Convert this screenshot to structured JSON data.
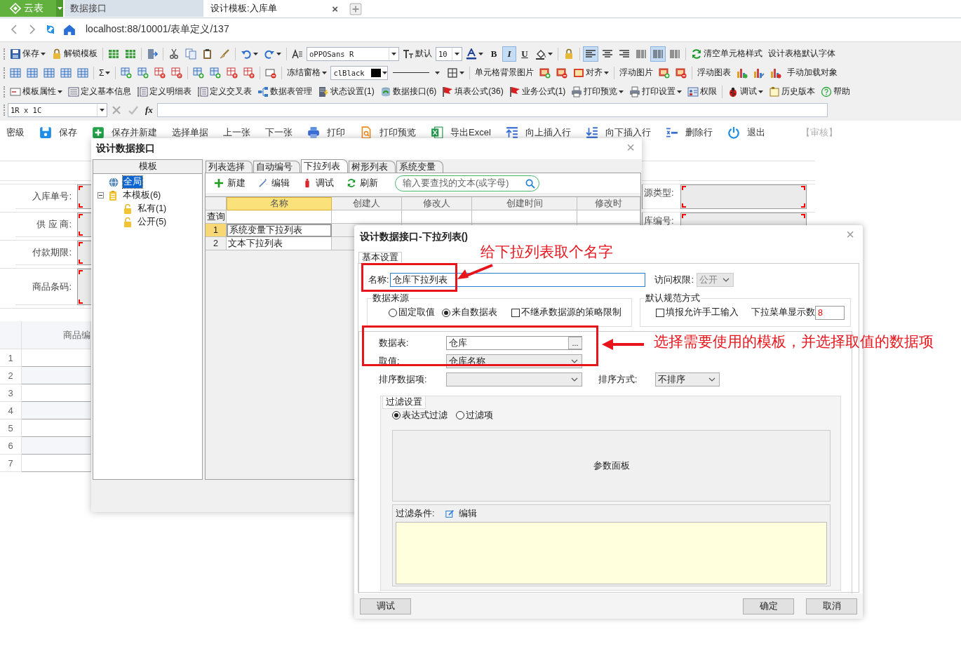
{
  "app_tabs": [
    {
      "kind": "logo",
      "label": "云表"
    },
    {
      "kind": "tab",
      "label": "数据接口",
      "selected": false
    },
    {
      "kind": "tab",
      "label": "设计模板:入库单",
      "selected": true,
      "close": "×"
    }
  ],
  "address": {
    "url": "localhost:88/10001/表单定义/137"
  },
  "toolbar": {
    "rows": [
      {
        "items": [
          {
            "kind": "button",
            "label": "保存",
            "menu": true
          },
          {
            "kind": "button",
            "label": "解锁模板",
            "menu": false
          },
          {
            "kind": "sep"
          },
          {
            "kind": "button",
            "menu": false
          },
          {
            "kind": "button",
            "menu": false
          },
          {
            "kind": "sep"
          },
          {
            "kind": "button",
            "menu": false
          },
          {
            "kind": "sep"
          },
          {
            "kind": "button",
            "menu": false
          },
          {
            "kind": "button",
            "menu": false
          },
          {
            "kind": "button",
            "menu": false
          },
          {
            "kind": "button",
            "menu": false
          },
          {
            "kind": "sep"
          },
          {
            "kind": "button",
            "menu": true
          },
          {
            "kind": "button",
            "menu": true
          },
          {
            "kind": "sep"
          },
          {
            "kind": "button",
            "menu": false
          },
          {
            "kind": "combo",
            "value": "oPPOSans R"
          },
          {
            "kind": "button",
            "label": "默认",
            "menu": false
          },
          {
            "kind": "combo",
            "value": "10"
          },
          {
            "kind": "button",
            "menu": true
          },
          {
            "kind": "toggle",
            "label": "B",
            "selected": false
          },
          {
            "kind": "toggle",
            "label": "I",
            "selected": true
          },
          {
            "kind": "toggle",
            "label": "U",
            "selected": false
          },
          {
            "kind": "button",
            "menu": true
          },
          {
            "kind": "sep"
          },
          {
            "kind": "button",
            "menu": false
          },
          {
            "kind": "sep"
          },
          {
            "kind": "toggle",
            "selected": true
          },
          {
            "kind": "toggle",
            "selected": false
          },
          {
            "kind": "toggle",
            "selected": false
          },
          {
            "kind": "toggle",
            "selected": false
          },
          {
            "kind": "toggle",
            "selected": true
          },
          {
            "kind": "toggle",
            "selected": false
          },
          {
            "kind": "sep"
          },
          {
            "kind": "button",
            "label": "清空单元格样式",
            "menu": false
          },
          {
            "kind": "text",
            "label": "设计表格默认字体",
            "menu": false
          }
        ]
      },
      {
        "items": [
          {
            "kind": "button",
            "menu": false
          },
          {
            "kind": "button",
            "menu": false
          },
          {
            "kind": "button",
            "menu": false
          },
          {
            "kind": "button",
            "menu": false
          },
          {
            "kind": "button",
            "menu": false
          },
          {
            "kind": "sep"
          },
          {
            "kind": "text",
            "label": "Σ",
            "menu": true
          },
          {
            "kind": "sep"
          },
          {
            "kind": "button",
            "menu": false
          },
          {
            "kind": "button",
            "menu": false
          },
          {
            "kind": "button",
            "menu": false
          },
          {
            "kind": "button",
            "menu": false
          },
          {
            "kind": "sep"
          },
          {
            "kind": "button",
            "menu": false
          },
          {
            "kind": "button",
            "menu": false
          },
          {
            "kind": "button",
            "menu": false
          },
          {
            "kind": "button",
            "menu": false
          },
          {
            "kind": "sep"
          },
          {
            "kind": "button",
            "menu": false
          },
          {
            "kind": "sep"
          },
          {
            "kind": "text",
            "label": "冻结窗格",
            "menu": true
          },
          {
            "kind": "color-combo",
            "value": "clBlack",
            "color": "#000000"
          },
          {
            "kind": "line-combo"
          },
          {
            "kind": "button",
            "menu": true
          },
          {
            "kind": "sep"
          },
          {
            "kind": "text",
            "label": "单元格背景图片",
            "menu": false
          },
          {
            "kind": "button",
            "menu": false
          },
          {
            "kind": "button",
            "menu": false
          },
          {
            "kind": "button",
            "label": "对齐",
            "menu": true
          },
          {
            "kind": "sep"
          },
          {
            "kind": "text",
            "label": "浮动图片",
            "menu": false
          },
          {
            "kind": "button",
            "menu": false
          },
          {
            "kind": "button",
            "menu": false
          },
          {
            "kind": "sep"
          },
          {
            "kind": "text",
            "label": "浮动图表",
            "menu": false
          },
          {
            "kind": "button",
            "menu": false
          },
          {
            "kind": "button",
            "menu": false
          },
          {
            "kind": "button",
            "menu": false
          },
          {
            "kind": "text",
            "label": "手动加载对象",
            "menu": false
          }
        ]
      },
      {
        "items": [
          {
            "kind": "button",
            "label": "模板属性",
            "menu": true
          },
          {
            "kind": "button",
            "label": "定义基本信息",
            "menu": false
          },
          {
            "kind": "button",
            "label": "定义明细表",
            "menu": false
          },
          {
            "kind": "button",
            "label": "定义交叉表",
            "menu": false
          },
          {
            "kind": "button",
            "label": "数据表管理",
            "menu": false
          },
          {
            "kind": "button",
            "label": "状态设置(1)",
            "menu": false
          },
          {
            "kind": "button",
            "label": "数据接口(6)",
            "menu": false
          },
          {
            "kind": "button",
            "label": "填表公式(36)",
            "menu": false
          },
          {
            "kind": "button",
            "label": "业务公式(1)",
            "menu": false
          },
          {
            "kind": "button",
            "label": "打印预览",
            "menu": true
          },
          {
            "kind": "button",
            "label": "打印设置",
            "menu": true
          },
          {
            "kind": "button",
            "label": "权限",
            "menu": false
          },
          {
            "kind": "sep"
          },
          {
            "kind": "button",
            "label": "调试",
            "menu": true
          },
          {
            "kind": "button",
            "label": "历史版本",
            "menu": false
          },
          {
            "kind": "button",
            "label": "帮助",
            "menu": false
          }
        ]
      }
    ],
    "formula": {
      "cell": "1R x 1C",
      "fx": "fx"
    }
  },
  "actions": [
    {
      "kind": "text",
      "label": "密級",
      "disabled": false
    },
    {
      "kind": "button",
      "label": "保存",
      "disabled": false
    },
    {
      "kind": "button",
      "label": "保存并新建",
      "disabled": false
    },
    {
      "kind": "text",
      "label": "选择单据",
      "disabled": false
    },
    {
      "kind": "text",
      "label": "上一张",
      "disabled": false
    },
    {
      "kind": "text",
      "label": "下一张",
      "disabled": false
    },
    {
      "kind": "button",
      "label": "打印",
      "disabled": false
    },
    {
      "kind": "button",
      "label": "打印预览",
      "disabled": false
    },
    {
      "kind": "button",
      "label": "导出Excel",
      "disabled": false
    },
    {
      "kind": "button",
      "label": "向上插入行",
      "disabled": false
    },
    {
      "kind": "button",
      "label": "向下插入行",
      "disabled": false
    },
    {
      "kind": "button",
      "label": "删除行",
      "disabled": false
    },
    {
      "kind": "button",
      "label": "退出",
      "disabled": false
    },
    {
      "kind": "text",
      "label": "【审核】",
      "disabled": true
    }
  ],
  "form": {
    "fields_left": [
      {
        "label": "入库单号:"
      },
      {
        "label": "供 应 商:"
      },
      {
        "label": "付款期限:"
      },
      {
        "label": "商品条码:"
      }
    ],
    "fields_right": [
      {
        "label": "源类型:"
      },
      {
        "label": "库编号:"
      }
    ],
    "detail": {
      "header": "商品编",
      "rows": [
        "1",
        "2",
        "3",
        "4",
        "5",
        "6",
        "7"
      ]
    }
  },
  "dialog_main": {
    "title": "设计数据接口",
    "close": "×",
    "tree": {
      "header": "模板",
      "items": [
        {
          "label": "全局",
          "selected": true
        },
        {
          "label": "本模板(6)",
          "selected": false,
          "expanded": true,
          "children": [
            {
              "label": "私有(1)",
              "selected": false
            },
            {
              "label": "公开(5)",
              "selected": false
            }
          ]
        }
      ]
    },
    "tabs": [
      {
        "label": "列表选择",
        "selected": false
      },
      {
        "label": "自动编号",
        "selected": false
      },
      {
        "label": "下拉列表",
        "selected": true
      },
      {
        "label": "树形列表",
        "selected": false
      },
      {
        "label": "系统变量",
        "selected": false
      }
    ],
    "tools": [
      {
        "label": "新建"
      },
      {
        "label": "编辑"
      },
      {
        "label": "调试"
      },
      {
        "label": "刷新"
      }
    ],
    "search": {
      "placeholder": "输入要查找的文本(或字母)"
    },
    "grid": {
      "columns": [
        {
          "label": "名称",
          "selected": true
        },
        {
          "label": "创建人",
          "selected": false
        },
        {
          "label": "修改人",
          "selected": false
        },
        {
          "label": "创建时间",
          "selected": false
        },
        {
          "label": "修改时",
          "selected": false
        }
      ],
      "filter_label": "查询",
      "rows": [
        {
          "index": "1",
          "name": "系统变量下拉列表",
          "selected": true
        },
        {
          "index": "2",
          "name": "文本下拉列表",
          "selected": false
        }
      ]
    }
  },
  "dialog_list": {
    "title": "设计数据接口-下拉列表()",
    "close": "×",
    "tab": "基本设置",
    "name": {
      "label": "名称:",
      "value": "仓库下拉列表"
    },
    "access": {
      "label": "访问权限:",
      "value": "公开",
      "disabled": true
    },
    "source": {
      "legend": "数据来源",
      "options": [
        {
          "label": "固定取值",
          "selected": false
        },
        {
          "label": "来自数据表",
          "selected": true
        }
      ],
      "no_inherit": {
        "label": "不继承数据源的策略限制",
        "checked": false
      }
    },
    "defaults": {
      "legend": "默认规范方式",
      "manual": {
        "label": "填报允许手工输入",
        "checked": false
      },
      "count": {
        "label": "下拉菜单显示数",
        "value": "8"
      }
    },
    "table": {
      "label": "数据表:",
      "value": "仓库",
      "browse": "..."
    },
    "value_field": {
      "label": "取值:",
      "value": "仓库名称"
    },
    "sort_field": {
      "label": "排序数据项:"
    },
    "sort_order": {
      "label": "排序方式:",
      "value": "不排序"
    },
    "filter": {
      "tab": "过滤设置",
      "modes": [
        {
          "label": "表达式过滤",
          "selected": true
        },
        {
          "label": "过滤项",
          "selected": false
        }
      ],
      "panel": "参数面板",
      "condition": {
        "label": "过滤条件:",
        "edit": "编辑"
      }
    },
    "buttons": [
      {
        "label": "调试"
      },
      {
        "label": "确定"
      },
      {
        "label": "取消"
      }
    ]
  },
  "annotations": [
    {
      "kind": "callout",
      "text": "给下拉列表取个名字"
    },
    {
      "kind": "callout",
      "text": "选择需要使用的模板，并选择取值的数据项"
    }
  ]
}
